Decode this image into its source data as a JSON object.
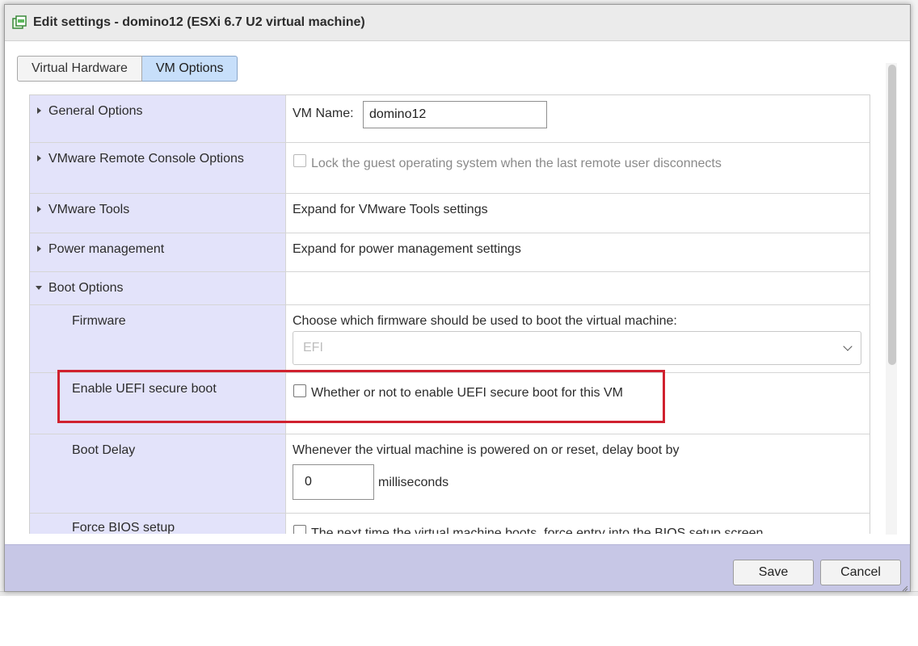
{
  "dialog": {
    "title": "Edit settings - domino12 (ESXi 6.7 U2 virtual machine)",
    "icon": "vm-settings-icon"
  },
  "tabs": [
    {
      "label": "Virtual Hardware",
      "active": false
    },
    {
      "label": "VM Options",
      "active": true
    }
  ],
  "sections": {
    "general": {
      "label": "General Options",
      "name_label": "VM Name:",
      "name_value": "domino12"
    },
    "remote_console": {
      "label": "VMware Remote Console Options",
      "lock_text": "Lock the guest operating system when the last remote user disconnects"
    },
    "tools": {
      "label": "VMware Tools",
      "text": "Expand for VMware Tools settings"
    },
    "power": {
      "label": "Power management",
      "text": "Expand for power management settings"
    },
    "boot": {
      "label": "Boot Options",
      "firmware": {
        "label": "Firmware",
        "text": "Choose which firmware should be used to boot the virtual machine:",
        "selected": "EFI"
      },
      "secure_boot": {
        "label": "Enable UEFI secure boot",
        "text": "Whether or not to enable UEFI secure boot for this VM",
        "checked": false
      },
      "boot_delay": {
        "label": "Boot Delay",
        "text": "Whenever the virtual machine is powered on or reset, delay boot by",
        "value": "0",
        "unit": "milliseconds"
      },
      "force_bios": {
        "label": "Force BIOS setup",
        "text": "The next time the virtual machine boots, force entry into the BIOS setup screen"
      }
    }
  },
  "footer": {
    "save_label": "Save",
    "cancel_label": "Cancel"
  },
  "colors": {
    "highlight": "#d0212f",
    "tab_active": "#c7dffa",
    "label_column": "#e3e3fa",
    "footer": "#c7c7e6"
  }
}
